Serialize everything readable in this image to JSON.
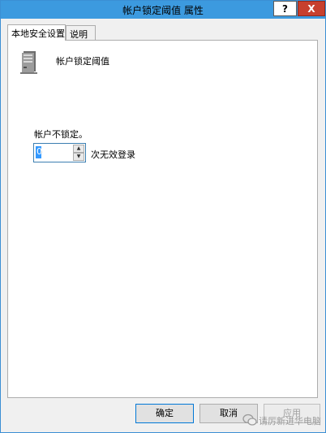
{
  "window": {
    "title": "帐户锁定阈值 属性",
    "help_label": "?",
    "close_label": "X"
  },
  "tabs": [
    {
      "label": "本地安全设置",
      "active": true
    },
    {
      "label": "说明",
      "active": false
    }
  ],
  "panel": {
    "heading": "帐户锁定阈值",
    "lock_label": "帐户不锁定。",
    "spinner_value": "0",
    "attempts_label": "次无效登录"
  },
  "buttons": {
    "ok": "确定",
    "cancel": "取消",
    "apply": "应用"
  },
  "watermark": "请厉新进华电脑",
  "colors": {
    "titlebar": "#3c9adf",
    "close": "#c7402e",
    "selection": "#3399ff"
  },
  "icons": [
    "server-icon",
    "spin-up-arrow-icon",
    "spin-down-arrow-icon",
    "wechat-icon"
  ]
}
